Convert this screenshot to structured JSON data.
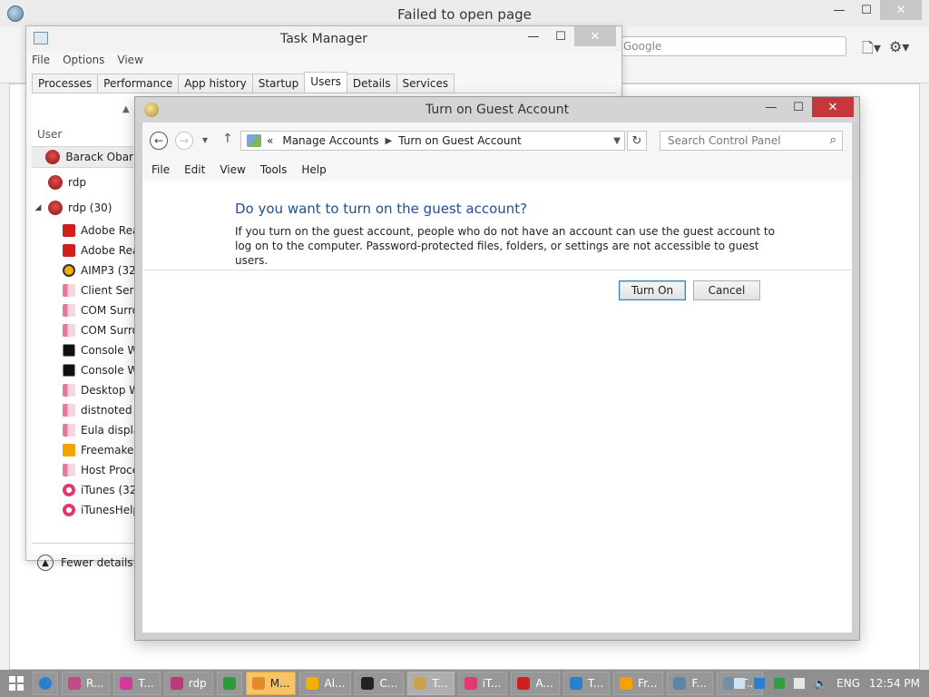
{
  "browser": {
    "title": "Failed to open page",
    "search_placeholder": "Google",
    "page_icon": "page-icon",
    "gear_icon": "gear-icon"
  },
  "taskmgr": {
    "title": "Task Manager",
    "menu": [
      "File",
      "Options",
      "View"
    ],
    "tabs": [
      "Processes",
      "Performance",
      "App history",
      "Startup",
      "Users",
      "Details",
      "Services"
    ],
    "active_tab": "Users",
    "column_user": "User",
    "users": [
      {
        "label": "Barack Obar",
        "selected": true
      },
      {
        "label": "rdp",
        "selected": false
      },
      {
        "label": "rdp (30)",
        "selected": false,
        "expanded": true
      }
    ],
    "processes": [
      {
        "label": "Adobe Rea",
        "icon": "pdf"
      },
      {
        "label": "Adobe Rea",
        "icon": "pdf"
      },
      {
        "label": "AIMP3 (32",
        "icon": "aimp"
      },
      {
        "label": "Client Serv",
        "icon": "generic"
      },
      {
        "label": "COM Surro",
        "icon": "generic"
      },
      {
        "label": "COM Surro",
        "icon": "generic"
      },
      {
        "label": "Console W",
        "icon": "console"
      },
      {
        "label": "Console W",
        "icon": "console"
      },
      {
        "label": "Desktop W",
        "icon": "generic"
      },
      {
        "label": "distnoted (",
        "icon": "generic"
      },
      {
        "label": "Eula displa",
        "icon": "generic"
      },
      {
        "label": "Freemake",
        "icon": "freemake"
      },
      {
        "label": "Host Proce",
        "icon": "generic"
      },
      {
        "label": "iTunes (32",
        "icon": "itunes"
      },
      {
        "label": "iTunesHelp",
        "icon": "itunes"
      }
    ],
    "fewer_details": "Fewer details"
  },
  "dialog": {
    "title": "Turn on Guest Account",
    "breadcrumb_prefix": "«",
    "breadcrumb": [
      "Manage Accounts",
      "Turn on Guest Account"
    ],
    "search_placeholder": "Search Control Panel",
    "menu": [
      "File",
      "Edit",
      "View",
      "Tools",
      "Help"
    ],
    "question": "Do you want to turn on the guest account?",
    "description": "If you turn on the guest account, people who do not have an account can use the guest account to log on to the computer. Password-protected files, folders, or settings are not accessible to guest users.",
    "btn_turn_on": "Turn On",
    "btn_cancel": "Cancel"
  },
  "taskbar": {
    "items": [
      {
        "label": "R...",
        "color": "#c04a8a"
      },
      {
        "label": "T...",
        "color": "#d23a9c"
      },
      {
        "label": "rdp",
        "color": "#b83a7a"
      },
      {
        "label": "",
        "color": "#2e9b3a"
      },
      {
        "label": "M...",
        "color": "#e58a2a",
        "active": true
      },
      {
        "label": "Al...",
        "color": "#f0b000"
      },
      {
        "label": "C...",
        "color": "#222222"
      },
      {
        "label": "T...",
        "color": "#c8a44a",
        "pressed": true
      },
      {
        "label": "iT...",
        "color": "#e23a6e"
      },
      {
        "label": "A...",
        "color": "#d01f1f"
      },
      {
        "label": "T...",
        "color": "#2a7fd0"
      },
      {
        "label": "Fr...",
        "color": "#f2a300"
      },
      {
        "label": "F...",
        "color": "#5a86a8"
      },
      {
        "label": "T...",
        "color": "#7290a8"
      }
    ],
    "language": "ENG",
    "time": "12:54 PM"
  }
}
